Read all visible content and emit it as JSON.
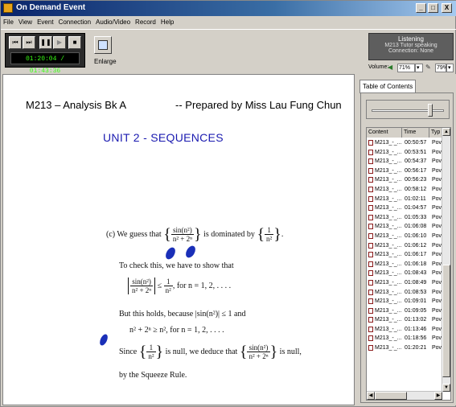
{
  "window": {
    "title": "On Demand Event",
    "controls": [
      "_",
      "□",
      "X"
    ]
  },
  "menu": [
    "File",
    "View",
    "Event",
    "Connection",
    "Audio/Video",
    "Record",
    "Help"
  ],
  "player": {
    "buttons": [
      "prev-icon",
      "next-icon",
      "pause-icon",
      "play-icon",
      "stop-icon"
    ],
    "timer": "01:20:04  /  01:43:36",
    "enlarge_label": "Enlarge"
  },
  "status": {
    "line1": "Listening",
    "line2": "M213 Tutor speaking",
    "line3": "Connection: None"
  },
  "volume": {
    "label": "Volume:",
    "value1": "71%",
    "value2": "79%"
  },
  "document": {
    "header_left": "M213 – Analysis Bk A",
    "header_right": "-- Prepared by Miss Lau Fung Chun",
    "unit_title": "UNIT 2 -  SEQUENCES",
    "line_c_prefix": "(c)  We guess that",
    "frac1_num": "sin(n²)",
    "frac1_den": "n² + 2ⁿ",
    "line_c_mid": "is dominated by",
    "frac2_num": "1",
    "frac2_den": "n²",
    "line_c_end": ".",
    "check_text": "To check this, we have to show that",
    "ineq_le": "≤",
    "ineq_frac_num": "1",
    "ineq_frac_den": "n²",
    "ineq_for": ",   for n = 1, 2, . . . .",
    "holds_text": "But this holds, because |sin(n²)| ≤ 1 and",
    "ineq2": "n² + 2ⁿ ≥ n²,   for n = 1, 2, . . . .",
    "since_prefix": "Since",
    "since_mid": "is null, we deduce that",
    "since_end": "is null,",
    "squeeze": "by the Squeeze Rule."
  },
  "toc": {
    "tab_label": "Table of Contents",
    "columns": [
      "Content",
      "Time",
      "Typ"
    ],
    "rows": [
      {
        "content": "M213_-_...",
        "time": "00:50:57",
        "type": "Pov"
      },
      {
        "content": "M213_-_...",
        "time": "00:53:51",
        "type": "Pov"
      },
      {
        "content": "M213_-_...",
        "time": "00:54:37",
        "type": "Pov"
      },
      {
        "content": "M213_-_...",
        "time": "00:56:17",
        "type": "Pov"
      },
      {
        "content": "M213_-_...",
        "time": "00:56:23",
        "type": "Pov"
      },
      {
        "content": "M213_-_...",
        "time": "00:58:12",
        "type": "Pov"
      },
      {
        "content": "M213_-_...",
        "time": "01:02:11",
        "type": "Pov"
      },
      {
        "content": "M213_-_...",
        "time": "01:04:57",
        "type": "Pov"
      },
      {
        "content": "M213_-_...",
        "time": "01:05:33",
        "type": "Pov"
      },
      {
        "content": "M213_-_...",
        "time": "01:06:08",
        "type": "Pov"
      },
      {
        "content": "M213_-_...",
        "time": "01:06:10",
        "type": "Pov"
      },
      {
        "content": "M213_-_...",
        "time": "01:06:12",
        "type": "Pov"
      },
      {
        "content": "M213_-_...",
        "time": "01:06:17",
        "type": "Pov"
      },
      {
        "content": "M213_-_...",
        "time": "01:06:18",
        "type": "Pov"
      },
      {
        "content": "M213_-_...",
        "time": "01:08:43",
        "type": "Pov"
      },
      {
        "content": "M213_-_...",
        "time": "01:08:49",
        "type": "Pov"
      },
      {
        "content": "M213_-_...",
        "time": "01:08:53",
        "type": "Pov"
      },
      {
        "content": "M213_-_...",
        "time": "01:09:01",
        "type": "Pov"
      },
      {
        "content": "M213_-_...",
        "time": "01:09:05",
        "type": "Pov"
      },
      {
        "content": "M213_-_...",
        "time": "01:13:02",
        "type": "Pov"
      },
      {
        "content": "M213_-_...",
        "time": "01:13:46",
        "type": "Pov"
      },
      {
        "content": "M213_-_...",
        "time": "01:18:56",
        "type": "Pov"
      },
      {
        "content": "M213_-_...",
        "time": "01:20:21",
        "type": "Pov"
      }
    ]
  }
}
